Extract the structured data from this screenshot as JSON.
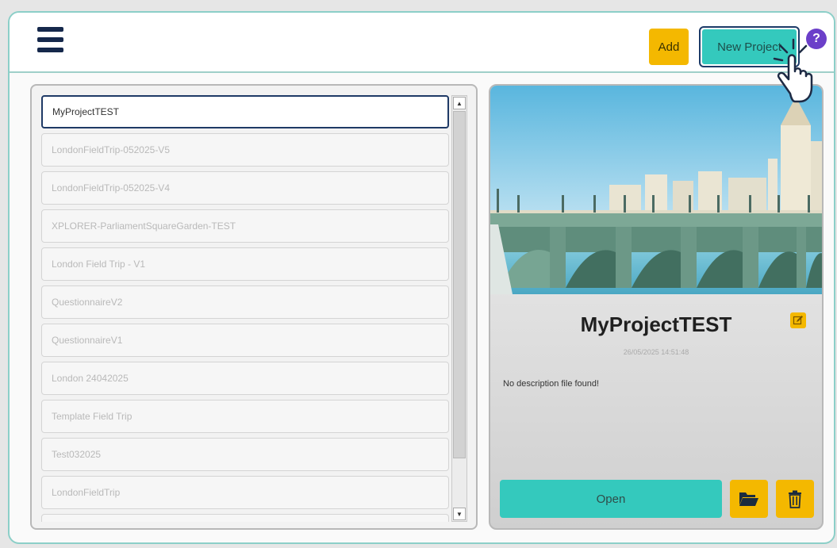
{
  "header": {
    "add_label": "Add",
    "new_project_label": "New Project",
    "help_label": "?"
  },
  "projects": [
    "MyProjectTEST",
    "LondonFieldTrip-052025-V5",
    "LondonFieldTrip-052025-V4",
    "XPLORER-ParliamentSquareGarden-TEST",
    "London Field Trip - V1",
    "QuestionnaireV2",
    "QuestionnaireV1",
    "London 24042025",
    "Template Field Trip",
    "Test032025",
    "LondonFieldTrip",
    ""
  ],
  "selected_index": 0,
  "details": {
    "title": "MyProjectTEST",
    "timestamp": "26/05/2025 14:51:48",
    "description": "No description file found!",
    "open_label": "Open"
  },
  "icons": {
    "menu": "hamburger-menu-icon",
    "help": "question-mark-icon",
    "edit": "pencil-edit-icon",
    "folder": "open-folder-icon",
    "trash": "trash-can-icon",
    "cursor": "hand-pointer-cursor-icon"
  },
  "colors": {
    "teal": "#34c9bd",
    "yellow": "#f4b800",
    "navy": "#15284b",
    "purple": "#6b3fc9"
  }
}
